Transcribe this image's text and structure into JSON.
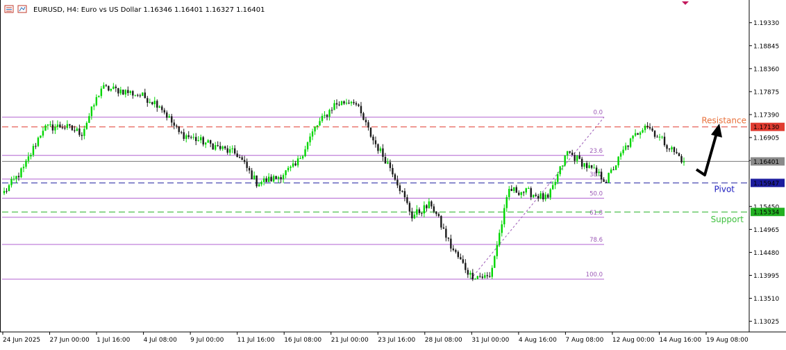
{
  "header": {
    "title": "EURUSD, H4:  Euro vs US Dollar  1.16346 1.16401 1.16327 1.16401",
    "icons": [
      "chart-properties-icon",
      "indicator-list-icon"
    ]
  },
  "colors": {
    "bull": "#00d600",
    "bear": "#1a1a1a",
    "resistance": "#e03c31",
    "pivot": "#2020a0",
    "support": "#22b022",
    "fib": "#b060d0",
    "current": "#777777",
    "arrow": "#000000"
  },
  "chart_data": {
    "type": "candlestick",
    "symbol": "EURUSD",
    "timeframe": "H4",
    "ylim": [
      1.128,
      1.1978
    ],
    "y_ticks": [
      "1.19330",
      "1.18845",
      "1.18360",
      "1.17875",
      "1.17390",
      "1.16905",
      "1.16420",
      "1.15450",
      "1.14965",
      "1.14480",
      "1.13995",
      "1.13510",
      "1.13025"
    ],
    "x_ticks": [
      "24 Jun 2025",
      "27 Jun 00:00",
      "1 Jul 16:00",
      "4 Jul 08:00",
      "9 Jul 00:00",
      "11 Jul 16:00",
      "16 Jul 08:00",
      "21 Jul 00:00",
      "23 Jul 16:00",
      "28 Jul 08:00",
      "31 Jul 00:00",
      "4 Aug 16:00",
      "7 Aug 08:00",
      "12 Aug 00:00",
      "14 Aug 16:00",
      "19 Aug 08:00"
    ],
    "close_anchors": [
      1.1575,
      1.1625,
      1.171,
      1.1715,
      1.17,
      1.1795,
      1.179,
      1.178,
      1.176,
      1.17,
      1.1685,
      1.167,
      1.1655,
      1.1595,
      1.1605,
      1.163,
      1.171,
      1.176,
      1.177,
      1.1685,
      1.162,
      1.1525,
      1.155,
      1.146,
      1.14,
      1.1395,
      1.158,
      1.1575,
      1.156,
      1.166,
      1.163,
      1.16,
      1.167,
      1.172,
      1.168,
      1.164
    ],
    "last_price": 1.16401,
    "levels": {
      "resistance": {
        "label": "Resistance",
        "value": 1.1713,
        "tag": "1.17130"
      },
      "pivot": {
        "label": "Pivot",
        "value": 1.15947,
        "tag": "1.15947"
      },
      "support": {
        "label": "Support",
        "value": 1.15334,
        "tag": "1.15334"
      },
      "current": {
        "value": 1.16401,
        "tag": "1.16401"
      }
    },
    "fibonacci": {
      "high": 1.17335,
      "low": 1.13915,
      "levels": [
        {
          "label": "0.0",
          "ratio": 0.0
        },
        {
          "label": "23.6",
          "ratio": 0.236
        },
        {
          "label": "38.2",
          "ratio": 0.382
        },
        {
          "label": "50.0",
          "ratio": 0.5
        },
        {
          "label": "61.8",
          "ratio": 0.618
        },
        {
          "label": "78.6",
          "ratio": 0.786
        },
        {
          "label": "100.0",
          "ratio": 1.0
        }
      ]
    }
  }
}
